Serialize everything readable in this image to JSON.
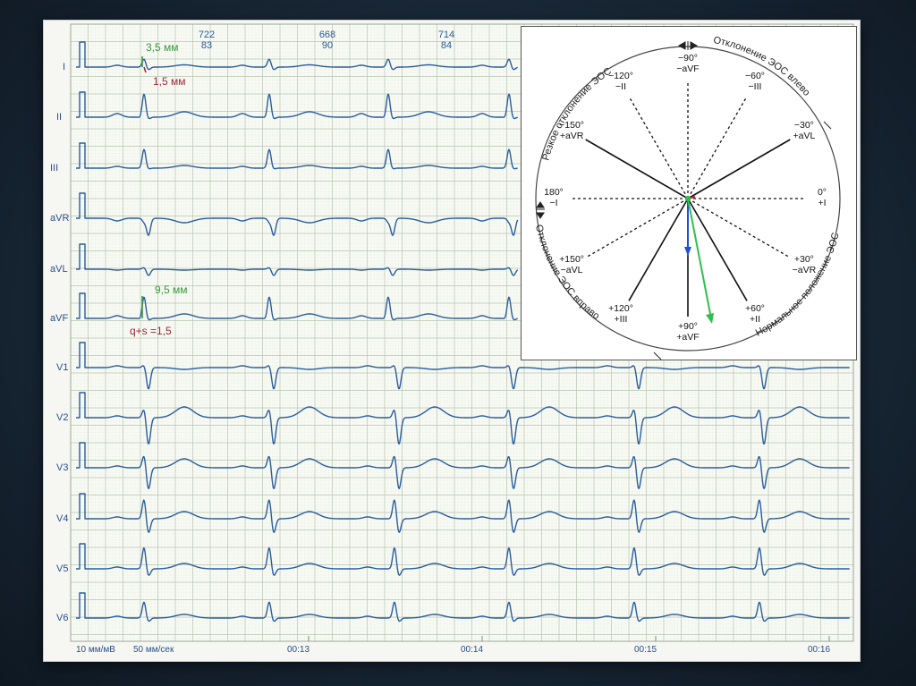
{
  "leads": [
    "I",
    "II",
    "III",
    "aVR",
    "aVL",
    "aVF",
    "V1",
    "V2",
    "V3",
    "V4",
    "V5",
    "V6"
  ],
  "rr_intervals": [
    {
      "ms": "722",
      "bpm": "83"
    },
    {
      "ms": "668",
      "bpm": "90"
    },
    {
      "ms": "714",
      "bpm": "84"
    }
  ],
  "annotations": {
    "lead1_r": "3,5 мм",
    "lead1_s": "1,5 мм",
    "avf_r": "9,5 мм",
    "avf_qs": "q+s =1,5"
  },
  "footer": {
    "gain": "10 мм/мВ",
    "speed": "50 мм/сек"
  },
  "time_marks": [
    "00:13",
    "00:14",
    "00:15",
    "00:16"
  ],
  "axis_diagram": {
    "sector_labels": {
      "top_left": "Резкое отклонение ЭОС",
      "top_right": "Отклонение ЭОС влево",
      "bottom_left": "Отклонение ЭОС вправо",
      "bottom_right": "Нормальное положение ЭОС"
    },
    "axes": [
      {
        "deg": "−90°",
        "lead": "−aVF",
        "solid": false
      },
      {
        "deg": "−60°",
        "lead": "−III",
        "solid": false
      },
      {
        "deg": "−30°",
        "lead": "+aVL",
        "solid": true
      },
      {
        "deg": "0°",
        "lead": "+I",
        "solid": false
      },
      {
        "deg": "+30°",
        "lead": "−aVR",
        "solid": false
      },
      {
        "deg": "+60°",
        "lead": "+II",
        "solid": true
      },
      {
        "deg": "+90°",
        "lead": "+aVF",
        "solid": true
      },
      {
        "deg": "+120°",
        "lead": "+III",
        "solid": true
      },
      {
        "deg": "+150°",
        "lead": "−aVL",
        "solid": false
      },
      {
        "deg": "180°",
        "lead": "−I",
        "solid": false
      },
      {
        "deg": "−150°",
        "lead": "+aVR",
        "solid": true
      },
      {
        "deg": "−120°",
        "lead": "−II",
        "solid": false
      }
    ]
  },
  "colors": {
    "trace": "#2a5d9e",
    "grid_major": "#b9c6b2",
    "grid_minor": "#dde4d7",
    "vector_blue": "#1f4fd6",
    "vector_green": "#2fbf4f",
    "vector_red": "#d92222"
  }
}
